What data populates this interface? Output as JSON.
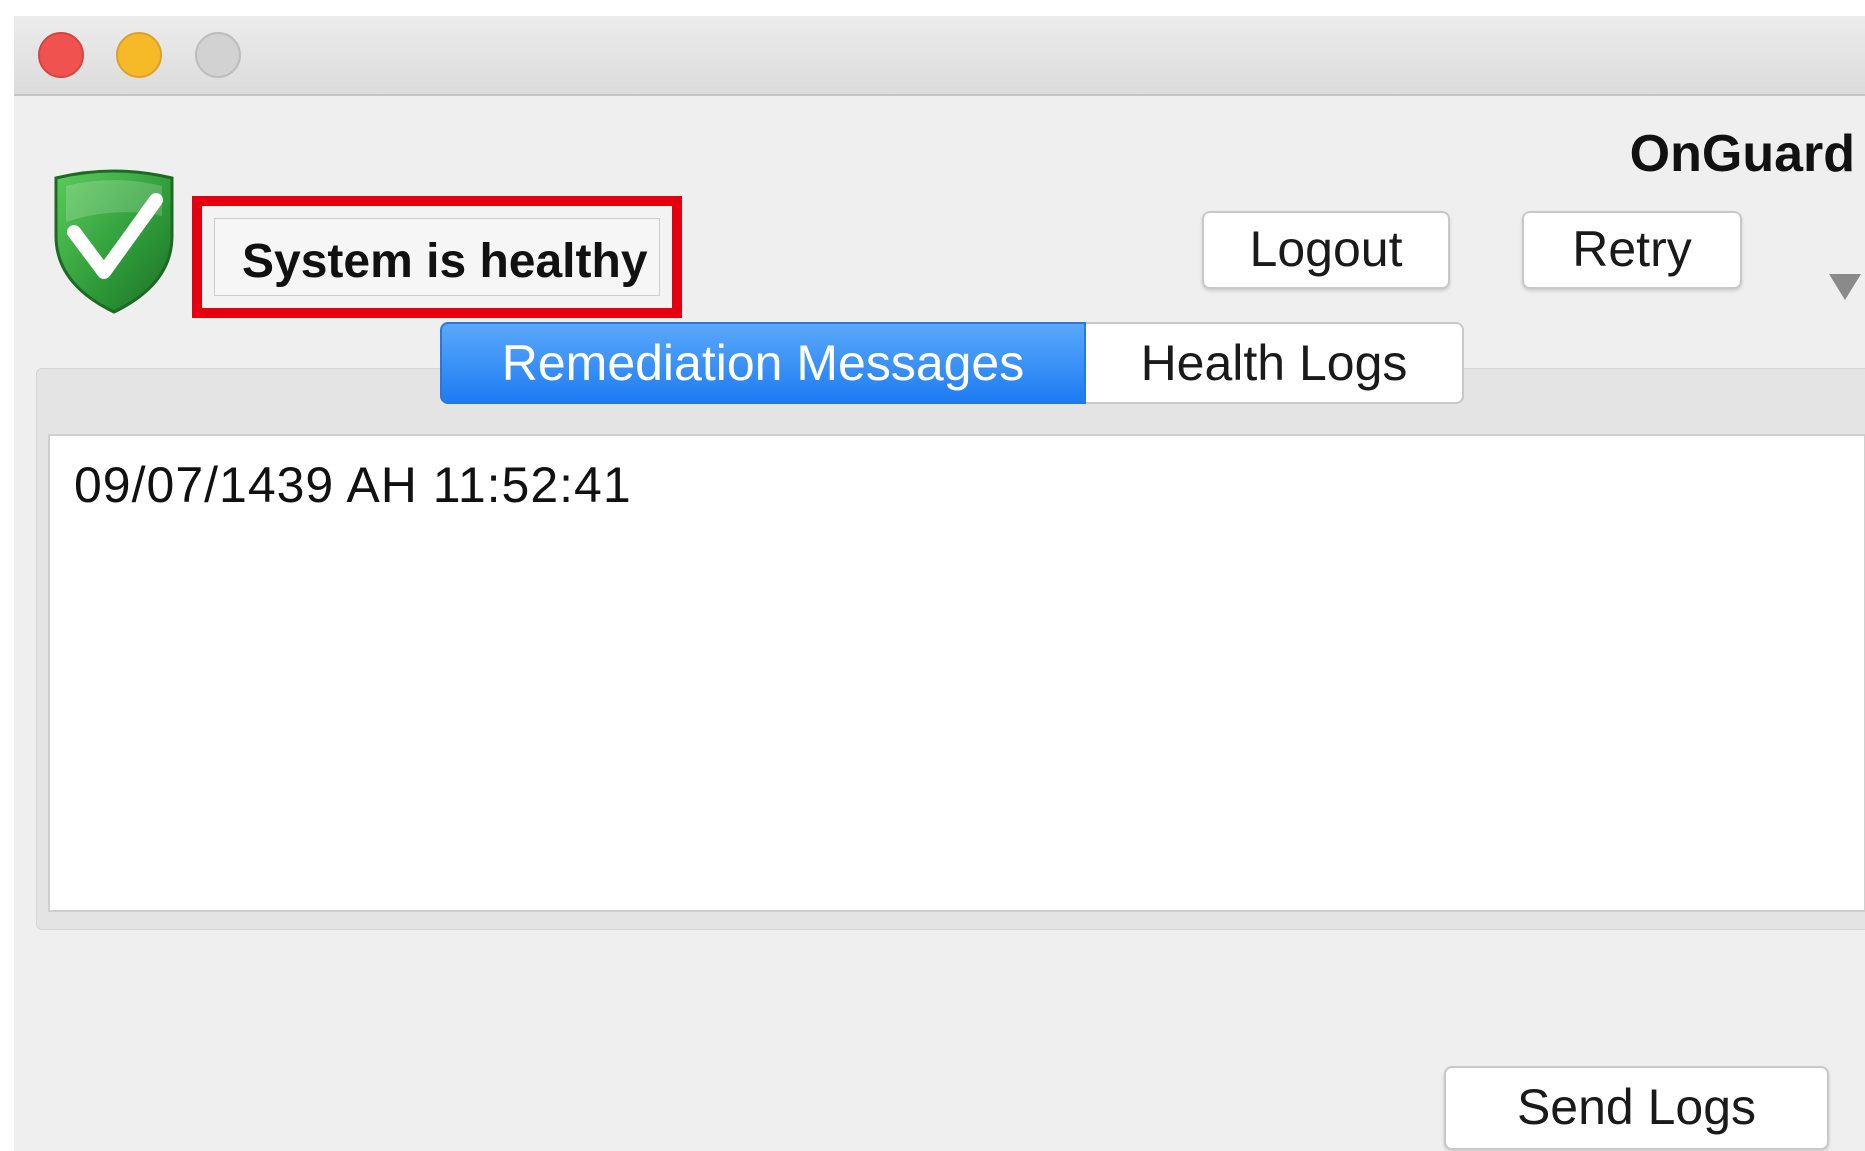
{
  "window": {
    "controls": [
      "close",
      "minimize",
      "zoom"
    ]
  },
  "header": {
    "app_name": "OnGuard",
    "status_icon": "shield-check-icon",
    "status_text": "System is healthy"
  },
  "toolbar": {
    "logout_label": "Logout",
    "retry_label": "Retry",
    "menu_icon": "dropdown-arrow-icon"
  },
  "tabs": [
    {
      "label": "Remediation Messages",
      "selected": true
    },
    {
      "label": "Health Logs",
      "selected": false
    }
  ],
  "log": {
    "entries": [
      "09/07/1439 AH 11:52:41"
    ]
  },
  "footer": {
    "send_logs_label": "Send Logs"
  },
  "colors": {
    "accent": "#1e7cf2",
    "highlight_border": "#e4000f",
    "shield_green": "#2f9e3a"
  }
}
